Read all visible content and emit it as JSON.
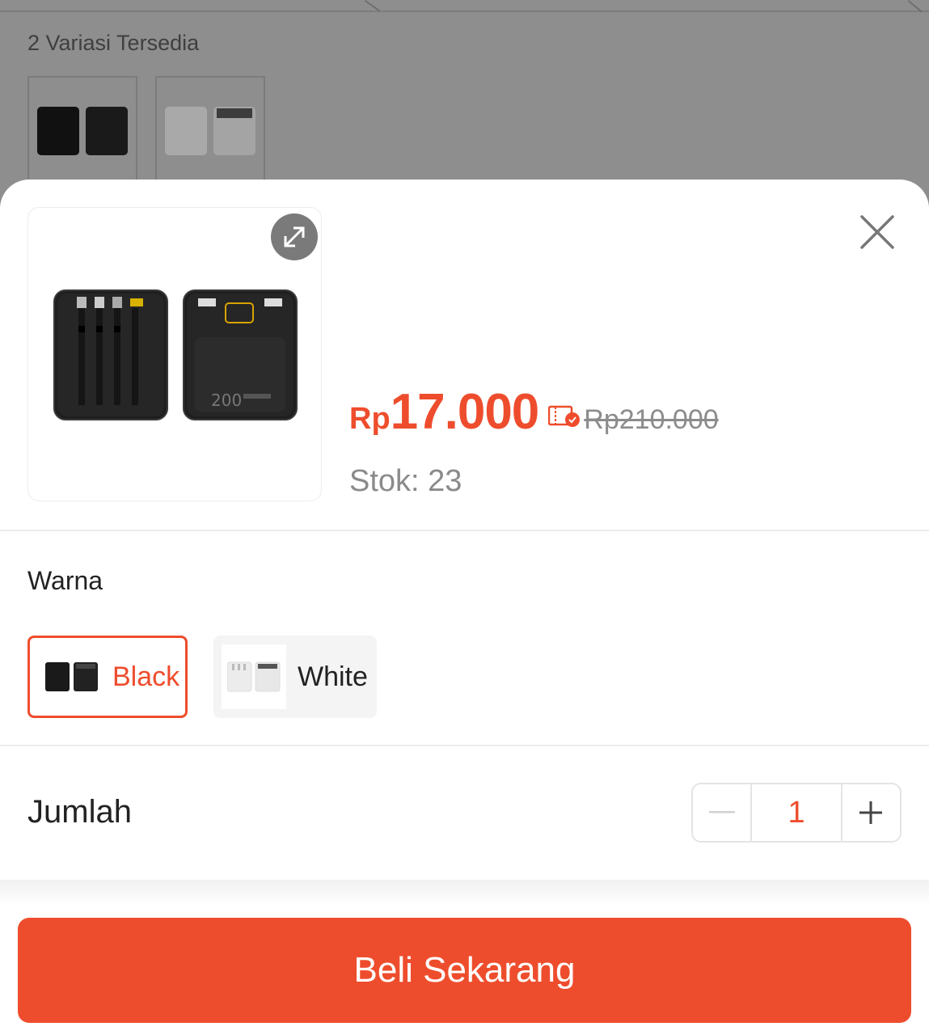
{
  "background": {
    "variations_text": "2 Variasi Tersedia",
    "thumbnails": [
      "power-bank-black-thumb",
      "power-bank-white-thumb"
    ]
  },
  "product": {
    "image_icon": "power-bank-image",
    "price_currency": "Rp",
    "price_value": "17.000",
    "original_price": "Rp210.000",
    "stock": "Stok: 23",
    "image_label": "200"
  },
  "icons": {
    "expand": "expand-icon",
    "close": "close-icon",
    "voucher": "voucher-icon",
    "minus": "minus-icon",
    "plus": "plus-icon"
  },
  "variation": {
    "label": "Warna",
    "options": [
      {
        "label": "Black",
        "selected": true
      },
      {
        "label": "White",
        "selected": false
      }
    ]
  },
  "quantity": {
    "label": "Jumlah",
    "value": "1"
  },
  "cta": {
    "label": "Beli Sekarang"
  },
  "colors": {
    "accent": "#ee4d2d",
    "overlay": "#8e8e8e"
  }
}
